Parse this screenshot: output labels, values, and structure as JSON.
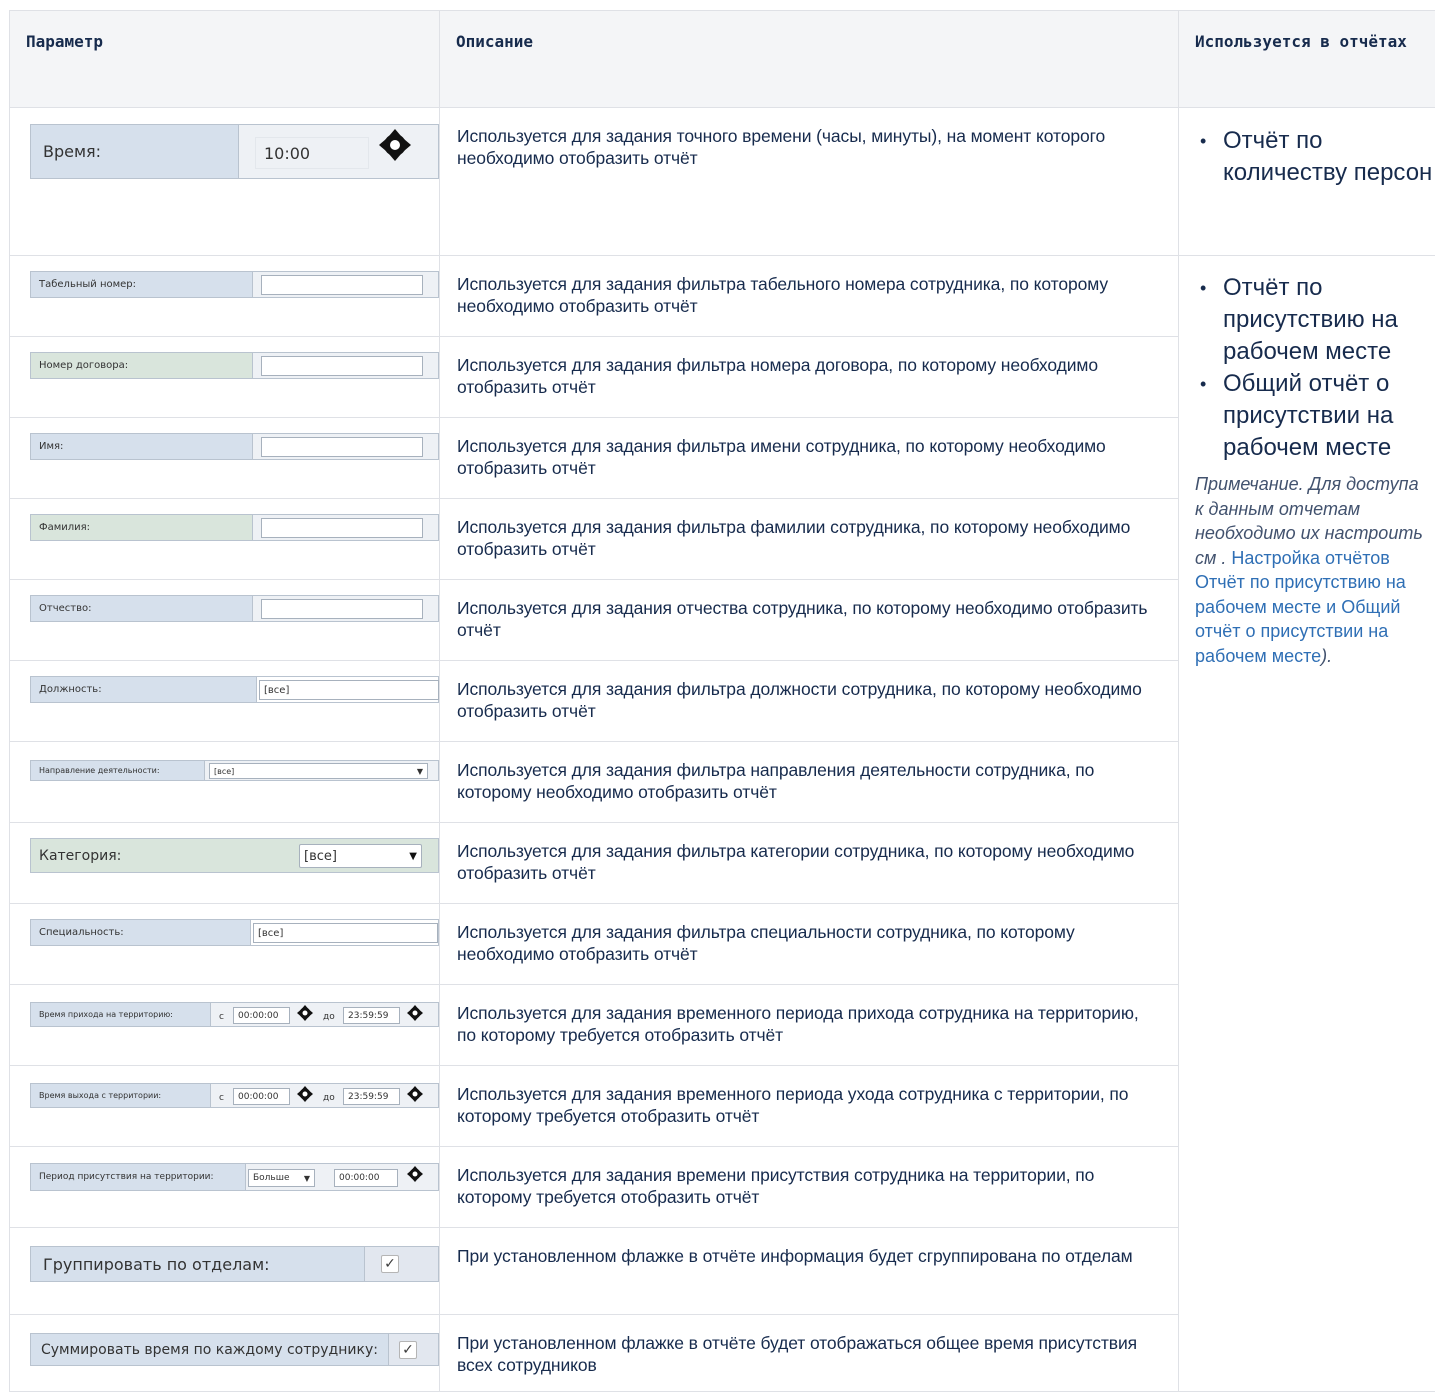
{
  "headers": {
    "param": "Параметр",
    "desc": "Описание",
    "used": "Используется в отчётах"
  },
  "rows": [
    {
      "widget": {
        "label": "Время:",
        "value": "10:00"
      },
      "desc": "Используется для задания точного времени (часы, минуты), на момент которого необходимо отобразить отчёт"
    },
    {
      "widget": {
        "label": "Табельный номер:",
        "value": ""
      },
      "desc": "Используется для задания фильтра табельного номера сотрудника, по которому необходимо отобразить отчёт"
    },
    {
      "widget": {
        "label": "Номер договора:",
        "value": ""
      },
      "desc": "Используется для задания фильтра номера договора, по которому необходимо отобразить отчёт"
    },
    {
      "widget": {
        "label": "Имя:",
        "value": ""
      },
      "desc": "Используется для задания фильтра имени сотрудника, по которому необходимо отобразить отчёт"
    },
    {
      "widget": {
        "label": "Фамилия:",
        "value": ""
      },
      "desc": "Используется для задания фильтра фамилии сотрудника, по которому необходимо отобразить отчёт"
    },
    {
      "widget": {
        "label": "Отчество:",
        "value": ""
      },
      "desc": "Используется для задания отчества сотрудника, по которому необходимо отобразить отчёт"
    },
    {
      "widget": {
        "label": "Должность:",
        "value": "[все]"
      },
      "desc": "Используется для задания фильтра должности сотрудника, по которому необходимо отобразить отчёт"
    },
    {
      "widget": {
        "label": "Направление деятельности:",
        "value": "[все]"
      },
      "desc": "Используется для задания фильтра направления деятельности сотрудника, по которому необходимо отобразить отчёт"
    },
    {
      "widget": {
        "label": "Категория:",
        "value": "[все]"
      },
      "desc": "Используется для задания фильтра категории сотрудника, по которому необходимо отобразить отчёт"
    },
    {
      "widget": {
        "label": "Специальность:",
        "value": "[все]"
      },
      "desc": "Используется для задания фильтра специальности сотрудника, по которому необходимо отобразить отчёт"
    },
    {
      "widget": {
        "label": "Время прихода на территорию:",
        "from_label": "с",
        "from": "00:00:00",
        "to_label": "до",
        "to": "23:59:59"
      },
      "desc": "Используется для задания временного периода прихода сотрудника на территорию, по которому требуется отобразить отчёт"
    },
    {
      "widget": {
        "label": "Время выхода с территории:",
        "from_label": "с",
        "from": "00:00:00",
        "to_label": "до",
        "to": "23:59:59"
      },
      "desc": "Используется для задания временного периода ухода сотрудника с территории, по которому требуется отобразить отчёт"
    },
    {
      "widget": {
        "label": "Период присутствия на территории:",
        "select": "Больше",
        "value": "00:00:00"
      },
      "desc": "Используется для задания времени присутствия сотрудника на территории, по которому требуется отобразить отчёт"
    },
    {
      "widget": {
        "label": "Группировать по отделам:",
        "checked": true
      },
      "desc": "При установленном флажке в отчёте информация будет сгруппирована по отделам"
    },
    {
      "widget": {
        "label": "Суммировать время по каждому сотруднику:",
        "checked": true
      },
      "desc": "При установленном флажке в отчёте будет отображаться общее время присутствия всех сотрудников"
    }
  ],
  "used_in": {
    "group1": [
      "Отчёт по количеству персон"
    ],
    "group2": [
      "Отчёт по присутствию на рабочем месте",
      "Общий отчёт о присутствии на рабочем месте"
    ],
    "note_prefix": "Примечание. Для доступа к данным отчетам необходимо их настроить см .",
    "note_link1": "Настройка отчётов Отчёт по присутствию на рабочем месте и Общий отчёт о присутствии на рабочем месте",
    "note_suffix": ")."
  }
}
